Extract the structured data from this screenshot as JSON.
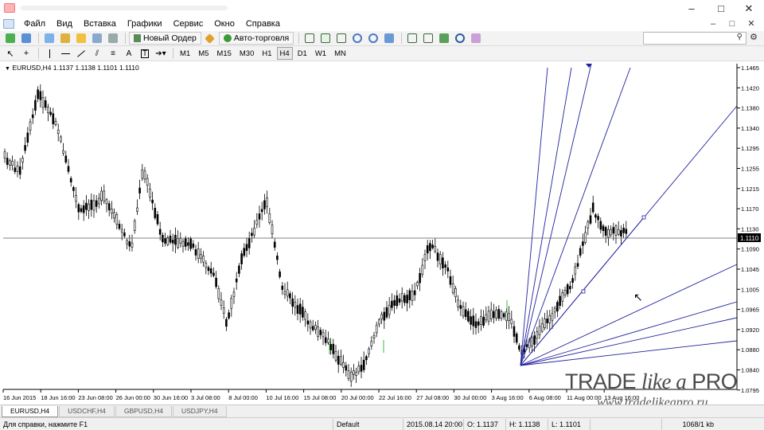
{
  "menu": {
    "items": [
      "Файл",
      "Вид",
      "Вставка",
      "Графики",
      "Сервис",
      "Окно",
      "Справка"
    ],
    "window_min": "–",
    "window_max": "□",
    "window_close": "✕"
  },
  "toolbar": {
    "new_order_label": "Новый Ордер",
    "auto_trading_label": "Авто-торговля",
    "timeframes": [
      "M1",
      "M5",
      "M15",
      "M30",
      "H1",
      "H4",
      "D1",
      "W1",
      "MN"
    ],
    "active_timeframe": "H4"
  },
  "chart": {
    "header": "EURUSD,H4  1.1137 1.1138 1.1101 1.1110",
    "current_price": "1.1110",
    "price_labels": [
      "1.1465",
      "1.1420",
      "1.1380",
      "1.1340",
      "1.1295",
      "1.1255",
      "1.1215",
      "1.1170",
      "1.1130",
      "1.1090",
      "1.1045",
      "1.1005",
      "1.0965",
      "1.0920",
      "1.0880",
      "1.0840",
      "1.0795"
    ],
    "time_labels": [
      "16 Jun 2015",
      "18 Jun 16:00",
      "23 Jun 08:00",
      "26 Jun 00:00",
      "30 Jun 16:00",
      "3 Jul 08:00",
      "8 Jul 00:00",
      "10 Jul 16:00",
      "15 Jul 08:00",
      "20 Jul 00:00",
      "22 Jul 16:00",
      "27 Jul 08:00",
      "30 Jul 00:00",
      "3 Aug 16:00",
      "6 Aug 08:00",
      "11 Aug 00:00",
      "13 Aug 16:00"
    ],
    "colors": {
      "grid_line": "#5a5a5a",
      "fan_lines": "#2020a0",
      "candles": "#000000",
      "bull_hint": "#3fb83f"
    }
  },
  "watermark": {
    "brand_a": "TRADE ",
    "brand_b": "like a",
    "brand_c": " PRO",
    "url": "www.tradelikeapro.ru"
  },
  "tabs": [
    "EURUSD,H4",
    "USDCHF,H4",
    "GBPUSD,H4",
    "USDJPY,H4"
  ],
  "status": {
    "help": "Для справки, нажмите F1",
    "profile": "Default",
    "datetime": "2015.08.14 20:00",
    "open": "O: 1.1137",
    "high": "H: 1.1138",
    "low": "L: 1.1101",
    "traffic": "1068/1 kb"
  }
}
